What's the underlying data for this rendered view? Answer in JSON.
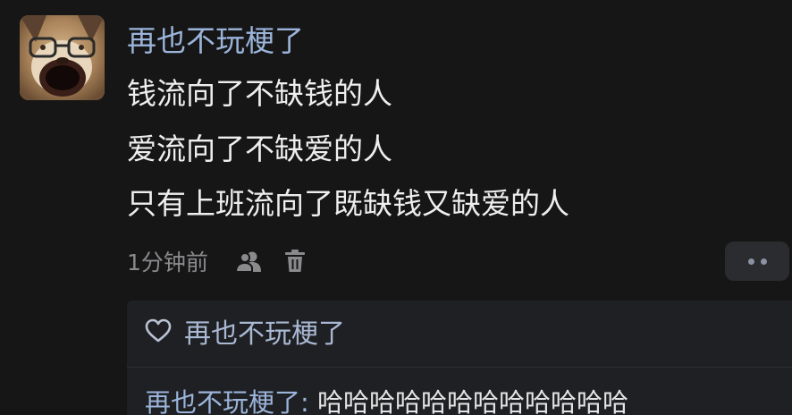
{
  "comment": {
    "username": "再也不玩梗了",
    "lines": [
      "钱流向了不缺钱的人",
      "爱流向了不缺爱的人",
      "只有上班流向了既缺钱又缺爱的人"
    ],
    "timestamp": "1分钟前",
    "icons": {
      "users": "users-icon",
      "delete": "trash-icon",
      "more": "more-dots-icon",
      "like": "heart-icon"
    }
  },
  "replies": {
    "liked_by": "再也不玩梗了",
    "items": [
      {
        "author": "再也不玩梗了",
        "separator": ": ",
        "text": "哈哈哈哈哈哈哈哈哈哈哈哈"
      }
    ]
  },
  "colors": {
    "background": "#161617",
    "username": "#9bb4da",
    "text": "#eeeeee",
    "muted": "#8a8a8c",
    "panel": "#1f2023"
  }
}
